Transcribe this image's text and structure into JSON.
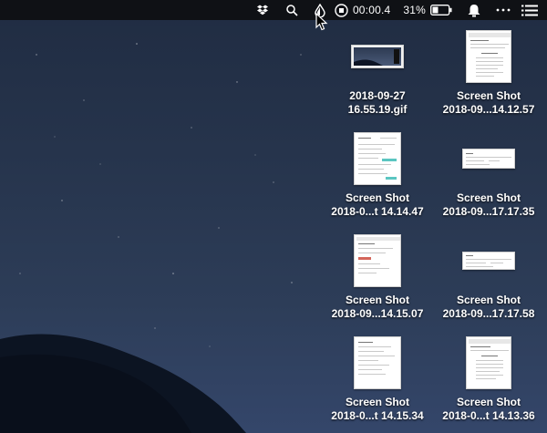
{
  "menubar": {
    "timer": "00:00.4",
    "battery_percent": "31%",
    "icons": [
      "dropbox-icon",
      "search-icon",
      "droplet-icon",
      "record-stop-icon",
      "battery-icon",
      "notification-icon",
      "more-icon",
      "list-icon"
    ]
  },
  "desktop_files": [
    {
      "line1": "2018-09-27",
      "line2": "16.55.19.gif"
    },
    {
      "line1": "Screen Shot",
      "line2": "2018-09...14.12.57"
    },
    {
      "line1": "Screen Shot",
      "line2": "2018-0...t 14.14.47"
    },
    {
      "line1": "Screen Shot",
      "line2": "2018-09...17.17.35"
    },
    {
      "line1": "Screen Shot",
      "line2": "2018-09...14.15.07"
    },
    {
      "line1": "Screen Shot",
      "line2": "2018-09...17.17.58"
    },
    {
      "line1": "Screen Shot",
      "line2": "2018-0...t 14.15.34"
    },
    {
      "line1": "Screen Shot",
      "line2": "2018-0...t 14.13.36"
    }
  ],
  "colors": {
    "menubar": "#0f1115",
    "wallpaper_top": "#202c42",
    "wallpaper_bottom": "#34466a",
    "mountain": "#0c1422",
    "thumbnail_accent": "#5bc6c1"
  }
}
